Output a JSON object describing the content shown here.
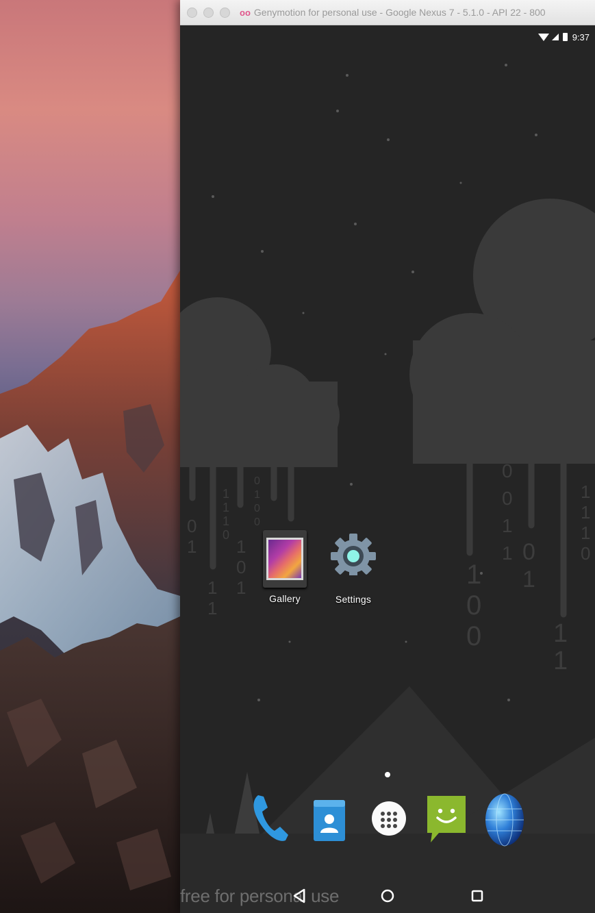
{
  "window": {
    "title": "Genymotion for personal use - Google Nexus 7 - 5.1.0 - API 22 - 800",
    "title_icon": "genymotion-logo-icon"
  },
  "statusbar": {
    "time": "9:37",
    "icons": [
      "wifi-icon",
      "signal-icon",
      "battery-icon"
    ]
  },
  "home": {
    "apps": [
      {
        "label": "Gallery",
        "icon": "gallery-icon"
      },
      {
        "label": "Settings",
        "icon": "settings-gear-icon"
      }
    ],
    "dock": [
      {
        "name": "phone",
        "icon": "phone-icon"
      },
      {
        "name": "contacts",
        "icon": "contacts-icon"
      },
      {
        "name": "app-drawer",
        "icon": "app-drawer-icon"
      },
      {
        "name": "messaging",
        "icon": "messaging-icon"
      },
      {
        "name": "browser",
        "icon": "globe-icon"
      }
    ],
    "wallpaper_digits_left": [
      "1",
      "1",
      "1",
      "0",
      "0",
      "1",
      "1",
      "1",
      "1",
      "0",
      "1",
      "0",
      "1",
      "0",
      "1",
      "1",
      "1"
    ],
    "wallpaper_digits_right": [
      "1",
      "0",
      "0",
      "0",
      "1",
      "1",
      "1",
      "1",
      "1",
      "0",
      "1",
      "1",
      "1",
      "1",
      "0",
      "0",
      "1",
      "1"
    ]
  },
  "navbar": {
    "back": "back-triangle-icon",
    "home": "home-circle-icon",
    "recents": "recents-square-icon"
  },
  "watermark": "free for personal use",
  "colors": {
    "screen_bg": "#252525",
    "cloud": "#3a3a3a",
    "title_accent": "#e0568b"
  }
}
